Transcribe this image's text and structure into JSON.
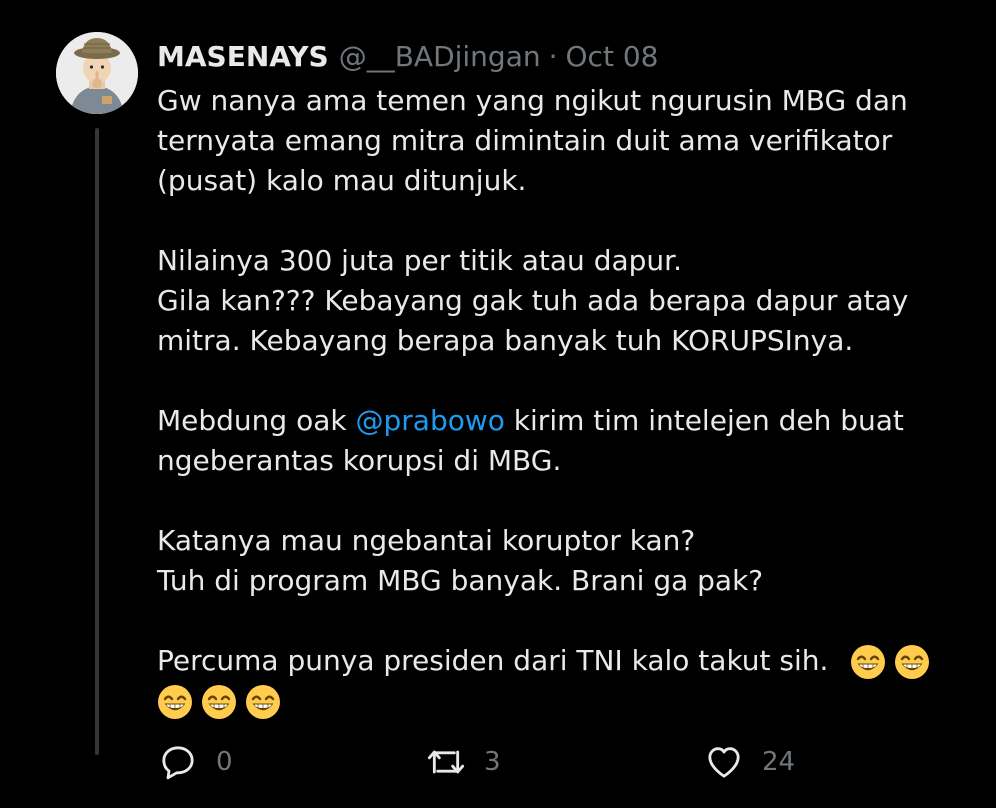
{
  "tweet": {
    "display_name": "MASENAYS",
    "handle": "@__BADjingan",
    "separator": "·",
    "date": "Oct 08",
    "body": {
      "p1": [
        "Gw nanya ama temen yang ngikut ngurusin MBG dan",
        "ternyata emang mitra dimintain duit ama verifikator",
        "(pusat) kalo mau ditunjuk."
      ],
      "p2": [
        "Nilainya 300 juta per titik atau dapur.",
        "Gila kan??? Kebayang gak tuh ada berapa dapur atay",
        "mitra. Kebayang berapa banyak tuh KORUPSInya."
      ],
      "p3_prefix": "Mebdung oak ",
      "p3_mention": "@prabowo",
      "p3_suffix": " kirim tim intelejen deh buat",
      "p3_line2": "ngeberantas korupsi di MBG.",
      "p4": [
        "Katanya mau ngebantai koruptor kan?",
        "Tuh di program MBG banyak. Brani ga pak?"
      ],
      "p5": "Percuma punya presiden dari TNI kalo takut sih.",
      "emoji_name": "grinning-face-with-smiling-eyes",
      "emoji_count": 5
    }
  },
  "actions": {
    "reply_count": "0",
    "retweet_count": "3",
    "like_count": "24"
  },
  "colors": {
    "background": "#000000",
    "text": "#e7e9ea",
    "muted": "#71767b",
    "mention": "#1d9bf0",
    "thread_line": "#333639"
  }
}
